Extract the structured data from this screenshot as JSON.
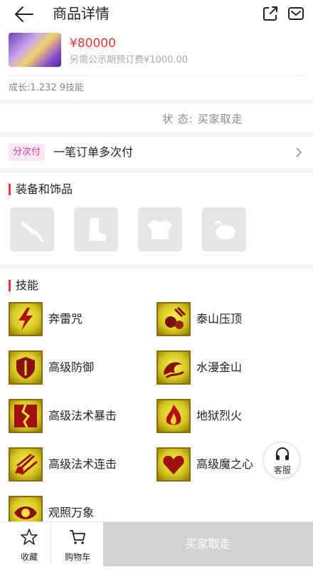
{
  "header": {
    "title": "商品详情",
    "back_icon": "arrow-left-icon",
    "share_icon": "share-icon",
    "message_icon": "mail-icon"
  },
  "product": {
    "price": "¥80000",
    "fee_note": "另需公示期预订费¥1000.00",
    "growth": "成长:1.232 9技能",
    "status": "状 态: 买家取走"
  },
  "payment": {
    "tag": "分次付",
    "text": "一笔订单多次付"
  },
  "equipment": {
    "title": "装备和饰品",
    "items": [
      {
        "icon": "weapon-icon"
      },
      {
        "icon": "boot-icon"
      },
      {
        "icon": "armor-icon"
      },
      {
        "icon": "accessory-icon"
      }
    ]
  },
  "skills": {
    "title": "技能",
    "items": [
      {
        "name": "奔雷咒",
        "icon": "lightning-icon"
      },
      {
        "name": "泰山压顶",
        "icon": "boulder-icon"
      },
      {
        "name": "高级防御",
        "icon": "shield-icon"
      },
      {
        "name": "水漫金山",
        "icon": "wave-icon"
      },
      {
        "name": "高级法术暴击",
        "icon": "crack-icon"
      },
      {
        "name": "地狱烈火",
        "icon": "fire-icon"
      },
      {
        "name": "高级法术连击",
        "icon": "burst-icon"
      },
      {
        "name": "高级魔之心",
        "icon": "heart-icon"
      },
      {
        "name": "观照万象",
        "icon": "eye-icon"
      }
    ]
  },
  "customer_service": {
    "label": "客服"
  },
  "bottom": {
    "favorite": "收藏",
    "cart": "购物车",
    "buy": "买家取走"
  },
  "colors": {
    "price": "#e33333",
    "accent": "#e33333",
    "tag_bg": "#fbe6f4",
    "disabled": "#d2d2d2"
  }
}
